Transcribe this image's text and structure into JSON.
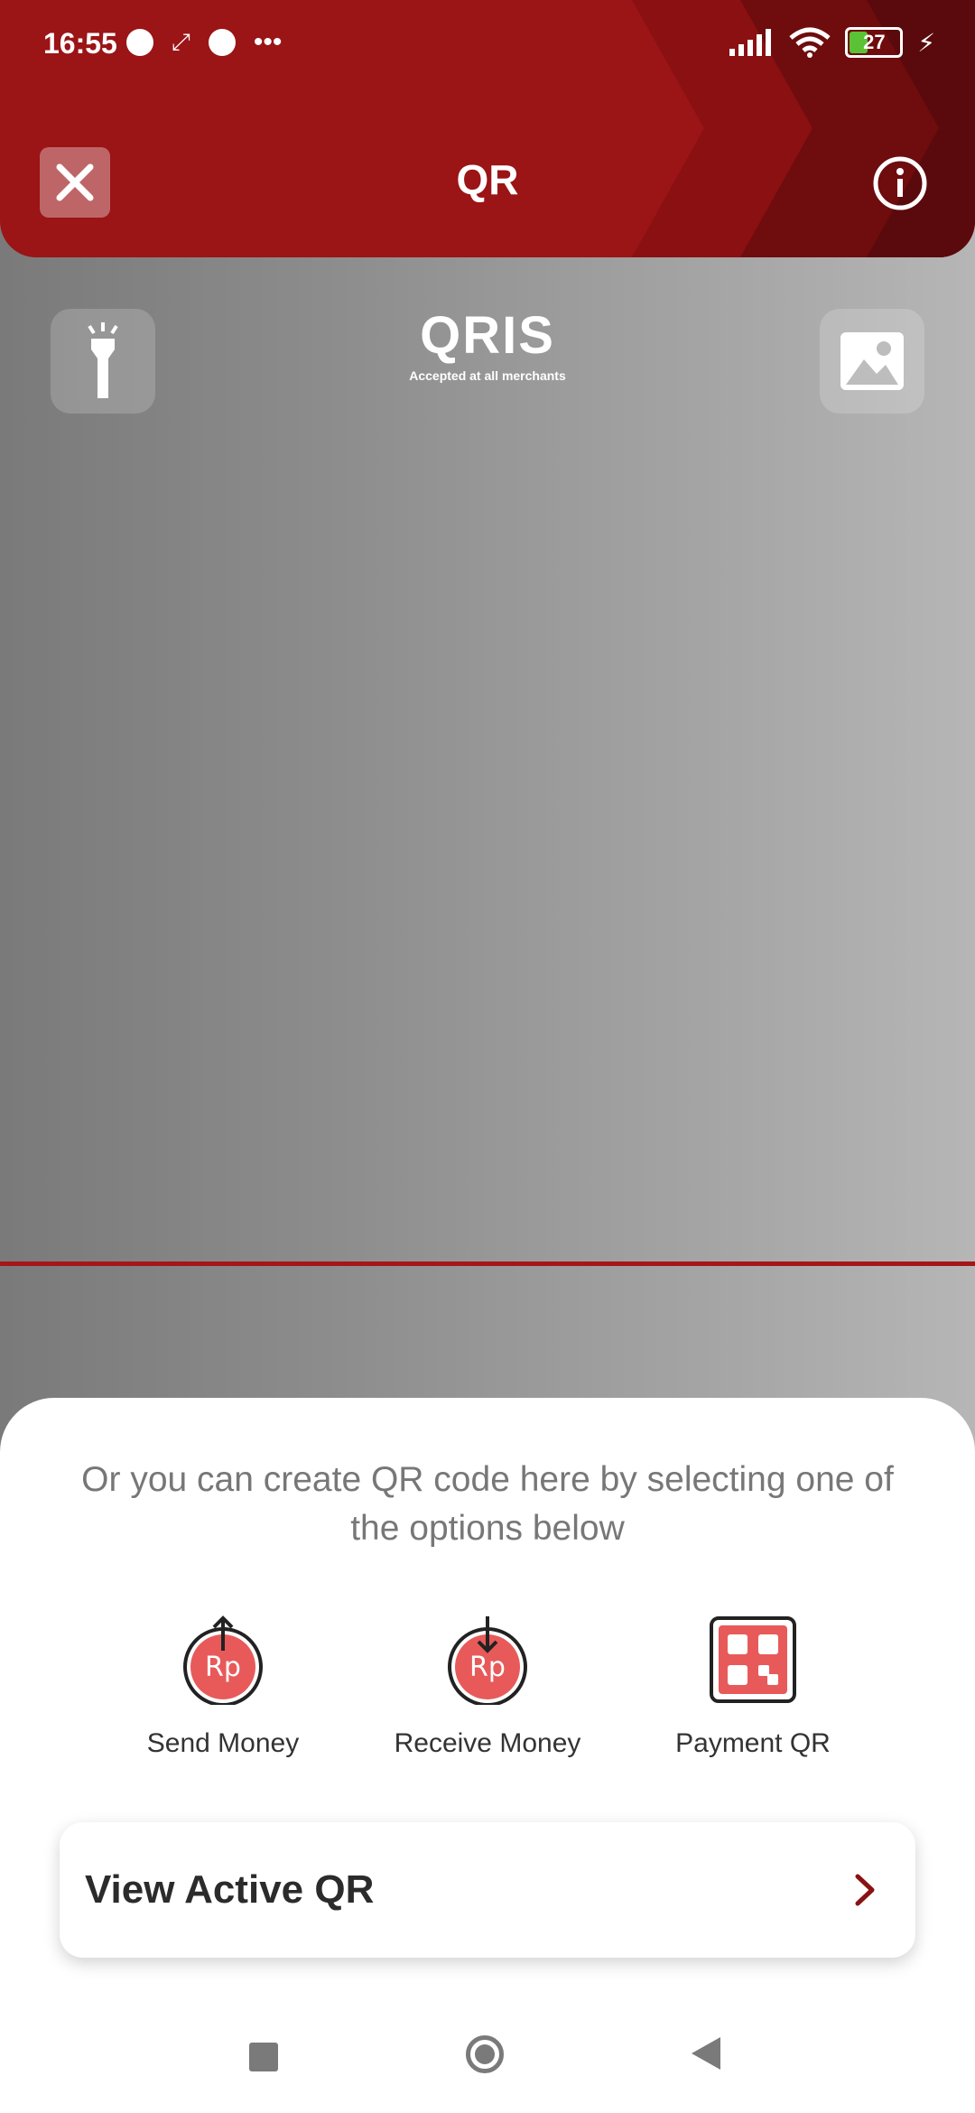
{
  "status_bar": {
    "time": "16:55",
    "battery": "27"
  },
  "header": {
    "title": "QR"
  },
  "camera": {
    "logo_text": "QRIS",
    "logo_tagline": "Accepted at all merchants"
  },
  "sheet": {
    "prompt": "Or you can create QR code here by selecting one of the options below",
    "options": [
      {
        "label": "Send Money",
        "icon": "send-money-icon"
      },
      {
        "label": "Receive Money",
        "icon": "receive-money-icon"
      },
      {
        "label": "Payment QR",
        "icon": "payment-qr-icon"
      }
    ],
    "view_active": "View Active QR"
  },
  "colors": {
    "brand": "#9b1416",
    "accent": "#e85a5a",
    "scan_line": "#a5161a"
  }
}
